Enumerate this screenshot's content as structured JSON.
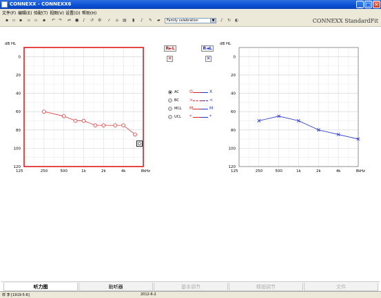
{
  "window": {
    "title": "CONNEXX - CONNEXX6",
    "minimize": "_",
    "maximize": "□",
    "close": "×"
  },
  "menu": [
    "文件(F)",
    "编辑(E)",
    "验配(T)",
    "视图(V)",
    "设置(O)",
    "帮助(H)"
  ],
  "toolbar": {
    "program_value": "Family celebration",
    "brand": "CONNEXX StandardFit"
  },
  "audiogram": {
    "unit_label": "dB HL",
    "hz_label": "Hz",
    "freq_labels": [
      "125",
      "250",
      "500",
      "1k",
      "2k",
      "4k",
      "8k"
    ],
    "db_labels": [
      "0",
      "20",
      "40",
      "60",
      "80",
      "100",
      "120"
    ],
    "right_ear_color": "#e03030",
    "left_ear_color": "#2030d0",
    "right_ear": {
      "marker": "O",
      "points": [
        [
          250,
          60
        ],
        [
          500,
          65
        ],
        [
          750,
          70
        ],
        [
          1000,
          70
        ],
        [
          1500,
          75
        ],
        [
          2000,
          75
        ],
        [
          3000,
          75
        ],
        [
          4000,
          75
        ],
        [
          6000,
          85
        ]
      ]
    },
    "left_ear": {
      "marker": "X",
      "points": [
        [
          250,
          70
        ],
        [
          500,
          65
        ],
        [
          1000,
          70
        ],
        [
          2000,
          80
        ],
        [
          4000,
          85
        ],
        [
          8000,
          90
        ]
      ]
    }
  },
  "controls": {
    "right_ear_button": "R►L",
    "left_ear_button": "R◄L",
    "mute_icon": "✕"
  },
  "legend": [
    {
      "label": "AC",
      "red": "O",
      "blue": "X",
      "selected": true
    },
    {
      "label": "BC",
      "red": ">",
      "blue": "<",
      "selected": false
    },
    {
      "label": "MCL",
      "red": "M",
      "blue": "M",
      "selected": false
    },
    {
      "label": "UCL",
      "red": "*",
      "blue": "*",
      "selected": false
    }
  ],
  "tabs": [
    {
      "label": "听力图",
      "state": "active"
    },
    {
      "label": "助听器",
      "state": "normal"
    },
    {
      "label": "基本调节",
      "state": "disabled"
    },
    {
      "label": "精细调节",
      "state": "disabled"
    },
    {
      "label": "文件",
      "state": "disabled"
    }
  ],
  "status": {
    "left": "样 李 [1919-5-6]",
    "date": "2012-6-2"
  }
}
